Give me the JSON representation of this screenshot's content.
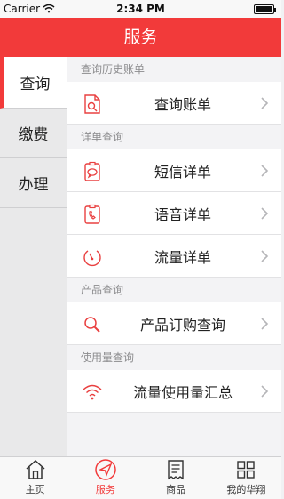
{
  "status_bar": {
    "carrier": "Carrier",
    "time": "2:34 PM"
  },
  "header": {
    "title": "服务"
  },
  "side_tabs": [
    {
      "label": "查询",
      "active": true
    },
    {
      "label": "缴费",
      "active": false
    },
    {
      "label": "办理",
      "active": false
    }
  ],
  "sections": [
    {
      "title": "查询历史账单",
      "items": [
        {
          "label": "查询账单",
          "icon": "bill-search-icon"
        }
      ]
    },
    {
      "title": "详单查询",
      "items": [
        {
          "label": "短信详单",
          "icon": "sms-detail-icon"
        },
        {
          "label": "语音详单",
          "icon": "voice-detail-icon"
        },
        {
          "label": "流量详单",
          "icon": "data-detail-icon"
        }
      ]
    },
    {
      "title": "产品查询",
      "items": [
        {
          "label": "产品订购查询",
          "icon": "search-icon"
        }
      ]
    },
    {
      "title": "使用量查询",
      "items": [
        {
          "label": "流量使用量汇总",
          "icon": "wifi-icon"
        }
      ]
    }
  ],
  "tabbar": [
    {
      "label": "主页",
      "icon": "home-icon",
      "active": false
    },
    {
      "label": "服务",
      "icon": "send-icon",
      "active": true
    },
    {
      "label": "商品",
      "icon": "receipt-icon",
      "active": false
    },
    {
      "label": "我的华翔",
      "icon": "grid-icon",
      "active": false
    }
  ],
  "colors": {
    "accent": "#f23a3a"
  }
}
